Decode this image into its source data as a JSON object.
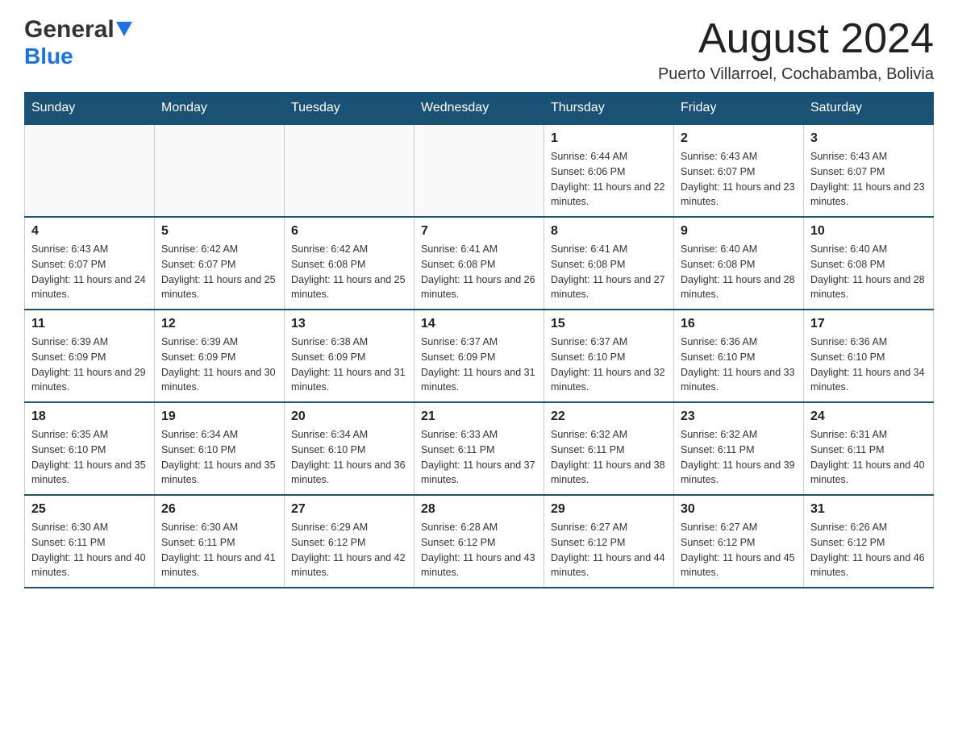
{
  "header": {
    "logo_general": "General",
    "logo_blue": "Blue",
    "month_title": "August 2024",
    "location": "Puerto Villarroel, Cochabamba, Bolivia"
  },
  "days_of_week": [
    "Sunday",
    "Monday",
    "Tuesday",
    "Wednesday",
    "Thursday",
    "Friday",
    "Saturday"
  ],
  "weeks": [
    [
      {
        "day": "",
        "info": ""
      },
      {
        "day": "",
        "info": ""
      },
      {
        "day": "",
        "info": ""
      },
      {
        "day": "",
        "info": ""
      },
      {
        "day": "1",
        "info": "Sunrise: 6:44 AM\nSunset: 6:06 PM\nDaylight: 11 hours and 22 minutes."
      },
      {
        "day": "2",
        "info": "Sunrise: 6:43 AM\nSunset: 6:07 PM\nDaylight: 11 hours and 23 minutes."
      },
      {
        "day": "3",
        "info": "Sunrise: 6:43 AM\nSunset: 6:07 PM\nDaylight: 11 hours and 23 minutes."
      }
    ],
    [
      {
        "day": "4",
        "info": "Sunrise: 6:43 AM\nSunset: 6:07 PM\nDaylight: 11 hours and 24 minutes."
      },
      {
        "day": "5",
        "info": "Sunrise: 6:42 AM\nSunset: 6:07 PM\nDaylight: 11 hours and 25 minutes."
      },
      {
        "day": "6",
        "info": "Sunrise: 6:42 AM\nSunset: 6:08 PM\nDaylight: 11 hours and 25 minutes."
      },
      {
        "day": "7",
        "info": "Sunrise: 6:41 AM\nSunset: 6:08 PM\nDaylight: 11 hours and 26 minutes."
      },
      {
        "day": "8",
        "info": "Sunrise: 6:41 AM\nSunset: 6:08 PM\nDaylight: 11 hours and 27 minutes."
      },
      {
        "day": "9",
        "info": "Sunrise: 6:40 AM\nSunset: 6:08 PM\nDaylight: 11 hours and 28 minutes."
      },
      {
        "day": "10",
        "info": "Sunrise: 6:40 AM\nSunset: 6:08 PM\nDaylight: 11 hours and 28 minutes."
      }
    ],
    [
      {
        "day": "11",
        "info": "Sunrise: 6:39 AM\nSunset: 6:09 PM\nDaylight: 11 hours and 29 minutes."
      },
      {
        "day": "12",
        "info": "Sunrise: 6:39 AM\nSunset: 6:09 PM\nDaylight: 11 hours and 30 minutes."
      },
      {
        "day": "13",
        "info": "Sunrise: 6:38 AM\nSunset: 6:09 PM\nDaylight: 11 hours and 31 minutes."
      },
      {
        "day": "14",
        "info": "Sunrise: 6:37 AM\nSunset: 6:09 PM\nDaylight: 11 hours and 31 minutes."
      },
      {
        "day": "15",
        "info": "Sunrise: 6:37 AM\nSunset: 6:10 PM\nDaylight: 11 hours and 32 minutes."
      },
      {
        "day": "16",
        "info": "Sunrise: 6:36 AM\nSunset: 6:10 PM\nDaylight: 11 hours and 33 minutes."
      },
      {
        "day": "17",
        "info": "Sunrise: 6:36 AM\nSunset: 6:10 PM\nDaylight: 11 hours and 34 minutes."
      }
    ],
    [
      {
        "day": "18",
        "info": "Sunrise: 6:35 AM\nSunset: 6:10 PM\nDaylight: 11 hours and 35 minutes."
      },
      {
        "day": "19",
        "info": "Sunrise: 6:34 AM\nSunset: 6:10 PM\nDaylight: 11 hours and 35 minutes."
      },
      {
        "day": "20",
        "info": "Sunrise: 6:34 AM\nSunset: 6:10 PM\nDaylight: 11 hours and 36 minutes."
      },
      {
        "day": "21",
        "info": "Sunrise: 6:33 AM\nSunset: 6:11 PM\nDaylight: 11 hours and 37 minutes."
      },
      {
        "day": "22",
        "info": "Sunrise: 6:32 AM\nSunset: 6:11 PM\nDaylight: 11 hours and 38 minutes."
      },
      {
        "day": "23",
        "info": "Sunrise: 6:32 AM\nSunset: 6:11 PM\nDaylight: 11 hours and 39 minutes."
      },
      {
        "day": "24",
        "info": "Sunrise: 6:31 AM\nSunset: 6:11 PM\nDaylight: 11 hours and 40 minutes."
      }
    ],
    [
      {
        "day": "25",
        "info": "Sunrise: 6:30 AM\nSunset: 6:11 PM\nDaylight: 11 hours and 40 minutes."
      },
      {
        "day": "26",
        "info": "Sunrise: 6:30 AM\nSunset: 6:11 PM\nDaylight: 11 hours and 41 minutes."
      },
      {
        "day": "27",
        "info": "Sunrise: 6:29 AM\nSunset: 6:12 PM\nDaylight: 11 hours and 42 minutes."
      },
      {
        "day": "28",
        "info": "Sunrise: 6:28 AM\nSunset: 6:12 PM\nDaylight: 11 hours and 43 minutes."
      },
      {
        "day": "29",
        "info": "Sunrise: 6:27 AM\nSunset: 6:12 PM\nDaylight: 11 hours and 44 minutes."
      },
      {
        "day": "30",
        "info": "Sunrise: 6:27 AM\nSunset: 6:12 PM\nDaylight: 11 hours and 45 minutes."
      },
      {
        "day": "31",
        "info": "Sunrise: 6:26 AM\nSunset: 6:12 PM\nDaylight: 11 hours and 46 minutes."
      }
    ]
  ]
}
